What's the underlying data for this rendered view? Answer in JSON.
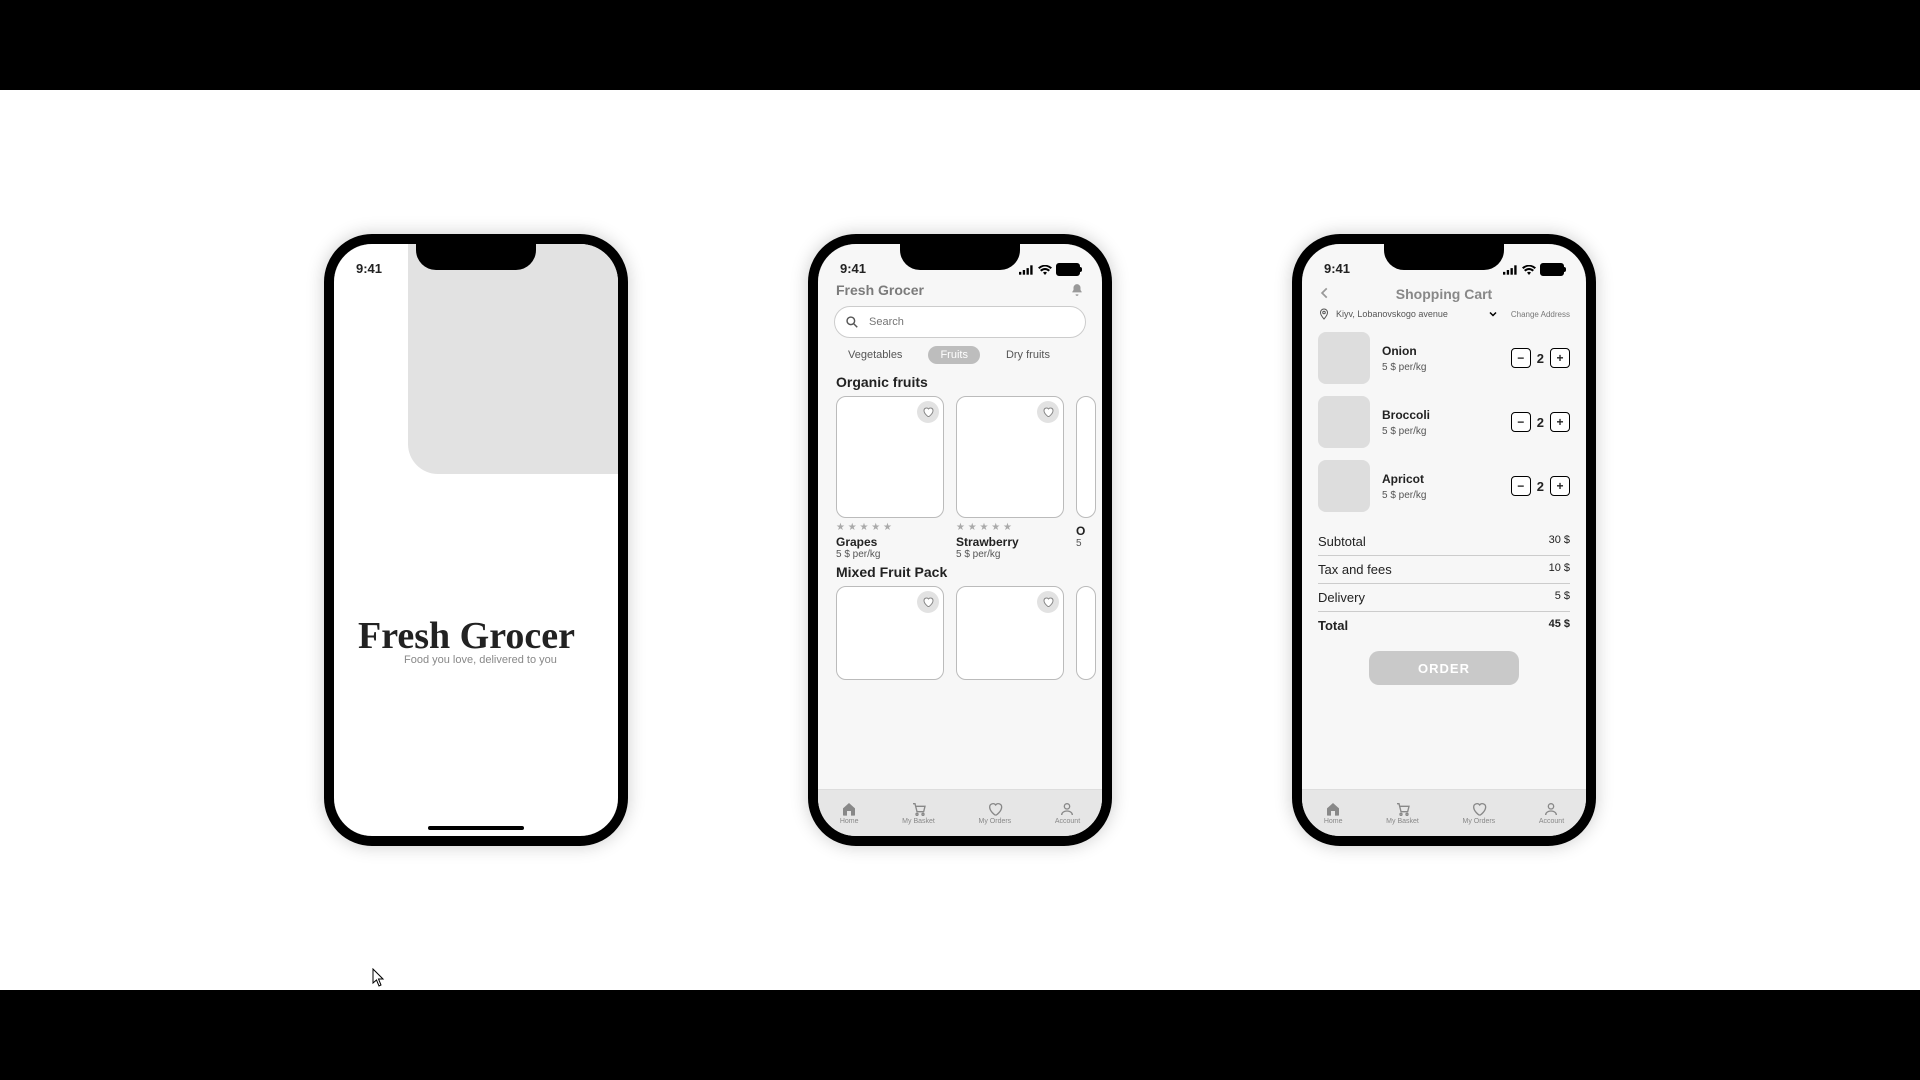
{
  "status_time": "9:41",
  "splash": {
    "title": "Fresh Grocer",
    "subtitle": "Food you love, delivered to you"
  },
  "listing": {
    "app_title": "Fresh Grocer",
    "search_placeholder": "Search",
    "categories": [
      "Vegetables",
      "Fruits",
      "Dry fruits"
    ],
    "section1_title": "Organic fruits",
    "section2_title": "Mixed Fruit Pack",
    "products": [
      {
        "name": "Grapes",
        "price": "5 $ per/kg"
      },
      {
        "name": "Strawberry",
        "price": "5 $ per/kg"
      },
      {
        "name": "O",
        "price": "5"
      }
    ],
    "bottom_nav": [
      "Home",
      "My Basket",
      "My Orders",
      "Account"
    ]
  },
  "cart": {
    "title": "Shopping Cart",
    "address": "Kiyv, Lobanovskogo avenue",
    "change_address": "Change Address",
    "items": [
      {
        "name": "Onion",
        "price": "5 $ per/kg",
        "qty": "2"
      },
      {
        "name": "Broccoli",
        "price": "5 $ per/kg",
        "qty": "2"
      },
      {
        "name": "Apricot",
        "price": "5 $ per/kg",
        "qty": "2"
      }
    ],
    "summary": {
      "subtotal_label": "Subtotal",
      "subtotal_value": "30 $",
      "tax_label": "Tax and fees",
      "tax_value": "10 $",
      "delivery_label": "Delivery",
      "delivery_value": "5 $",
      "total_label": "Total",
      "total_value": "45 $"
    },
    "order_button": "ORDER"
  }
}
